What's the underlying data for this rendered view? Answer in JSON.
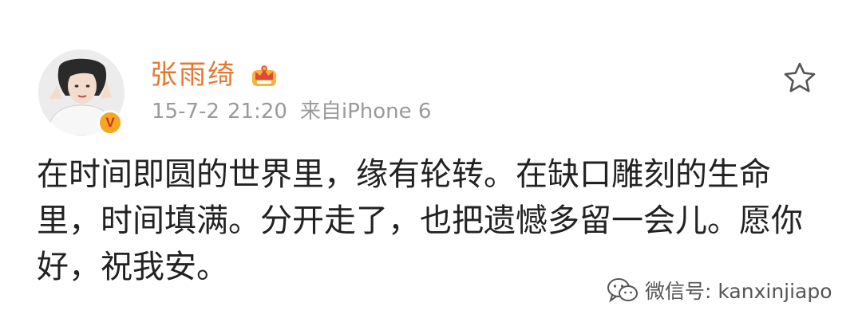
{
  "post": {
    "author": "张雨绮",
    "date": "15-7-2",
    "time": "21:20",
    "source": "来自iPhone 6",
    "text_lines": [
      "在时间即圆的世界里，缘有轮转。在缺口雕刻的生命",
      "里，时间填满。分开走了，也把遗憾多留一会儿。愿你",
      "好，祝我安。"
    ]
  },
  "badge": {
    "verified_mark": "V"
  },
  "watermark": {
    "text": "微信号: kanxinjiapo"
  },
  "colors": {
    "author_name": "#e8772e",
    "meta_text": "#9a9a9a",
    "badge_bg": "#f5a623",
    "badge_v": "#d22b1f",
    "body_text": "#222222"
  },
  "icons": {
    "favorite": "star-outline-icon",
    "member": "crown-icon",
    "watermark": "wechat-icon"
  }
}
